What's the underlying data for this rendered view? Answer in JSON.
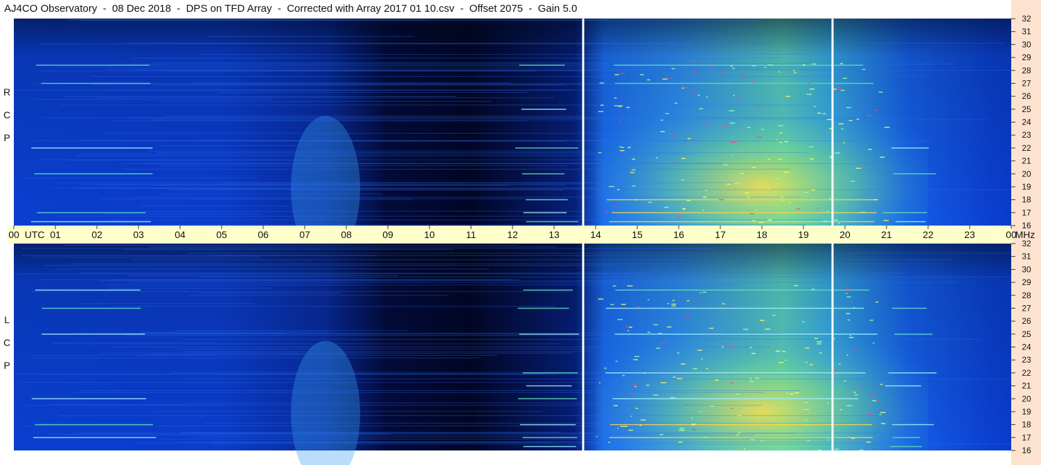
{
  "title": {
    "segments": [
      "AJ4CO Observatory",
      "08 Dec 2018",
      "DPS on TFD Array",
      "Corrected with Array 2017 01 10.csv",
      "Offset 2075",
      "Gain 5.0"
    ],
    "separator": "  -  "
  },
  "panels": [
    {
      "label_chars": [
        "R",
        "C",
        "P"
      ]
    },
    {
      "label_chars": [
        "L",
        "C",
        "P"
      ]
    }
  ],
  "colors": {
    "background": "#ffffff",
    "time_axis_band": "#ffffcc",
    "freq_axis_band": "#fde3cf",
    "spectrum_dark": "#000010",
    "spectrum_mid": "#0046e6",
    "spectrum_bright": "#ffe14a",
    "gap_line": "#ffffff"
  },
  "chart_data": {
    "type": "heatmap",
    "description_visible": "dynamic spectrogram",
    "x_axis": {
      "unit_label": "UTC",
      "tick_labels": [
        "00",
        "01",
        "02",
        "03",
        "04",
        "05",
        "06",
        "07",
        "08",
        "09",
        "10",
        "11",
        "12",
        "13",
        "14",
        "15",
        "16",
        "17",
        "18",
        "19",
        "20",
        "21",
        "22",
        "23",
        "00"
      ],
      "range_hours": [
        0,
        24
      ]
    },
    "y_axis": {
      "unit_label": "MHz",
      "tick_labels": [
        "16",
        "17",
        "18",
        "19",
        "20",
        "21",
        "22",
        "23",
        "24",
        "25",
        "26",
        "27",
        "28",
        "29",
        "30",
        "31",
        "32"
      ],
      "range_mhz": [
        16,
        32
      ]
    },
    "data_gaps_utc_hours": [
      13.7,
      19.7
    ],
    "features": {
      "night_dark_window_utc": [
        7.5,
        13.7
      ],
      "bright_activity_window_utc": [
        14.0,
        22.0
      ],
      "brightest_utc": 19.0,
      "bright_bands_mhz": [
        16.3,
        17.0,
        18.0,
        20.0,
        21.0,
        22.0,
        25.0,
        27.0,
        28.4
      ]
    }
  }
}
